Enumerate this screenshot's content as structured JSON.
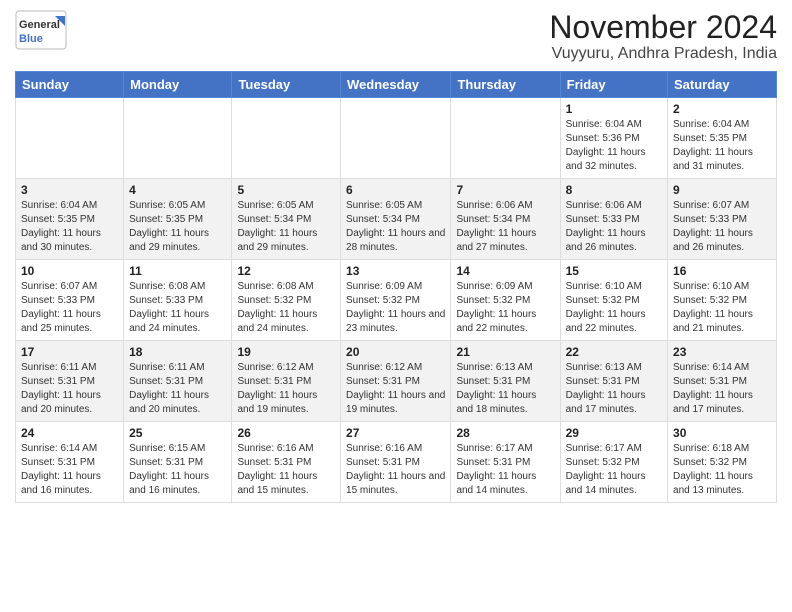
{
  "logo": {
    "line1": "General",
    "line2": "Blue"
  },
  "header": {
    "month": "November 2024",
    "location": "Vuyyuru, Andhra Pradesh, India"
  },
  "weekdays": [
    "Sunday",
    "Monday",
    "Tuesday",
    "Wednesday",
    "Thursday",
    "Friday",
    "Saturday"
  ],
  "weeks": [
    [
      {
        "day": "",
        "info": ""
      },
      {
        "day": "",
        "info": ""
      },
      {
        "day": "",
        "info": ""
      },
      {
        "day": "",
        "info": ""
      },
      {
        "day": "",
        "info": ""
      },
      {
        "day": "1",
        "info": "Sunrise: 6:04 AM\nSunset: 5:36 PM\nDaylight: 11 hours and 32 minutes."
      },
      {
        "day": "2",
        "info": "Sunrise: 6:04 AM\nSunset: 5:35 PM\nDaylight: 11 hours and 31 minutes."
      }
    ],
    [
      {
        "day": "3",
        "info": "Sunrise: 6:04 AM\nSunset: 5:35 PM\nDaylight: 11 hours and 30 minutes."
      },
      {
        "day": "4",
        "info": "Sunrise: 6:05 AM\nSunset: 5:35 PM\nDaylight: 11 hours and 29 minutes."
      },
      {
        "day": "5",
        "info": "Sunrise: 6:05 AM\nSunset: 5:34 PM\nDaylight: 11 hours and 29 minutes."
      },
      {
        "day": "6",
        "info": "Sunrise: 6:05 AM\nSunset: 5:34 PM\nDaylight: 11 hours and 28 minutes."
      },
      {
        "day": "7",
        "info": "Sunrise: 6:06 AM\nSunset: 5:34 PM\nDaylight: 11 hours and 27 minutes."
      },
      {
        "day": "8",
        "info": "Sunrise: 6:06 AM\nSunset: 5:33 PM\nDaylight: 11 hours and 26 minutes."
      },
      {
        "day": "9",
        "info": "Sunrise: 6:07 AM\nSunset: 5:33 PM\nDaylight: 11 hours and 26 minutes."
      }
    ],
    [
      {
        "day": "10",
        "info": "Sunrise: 6:07 AM\nSunset: 5:33 PM\nDaylight: 11 hours and 25 minutes."
      },
      {
        "day": "11",
        "info": "Sunrise: 6:08 AM\nSunset: 5:33 PM\nDaylight: 11 hours and 24 minutes."
      },
      {
        "day": "12",
        "info": "Sunrise: 6:08 AM\nSunset: 5:32 PM\nDaylight: 11 hours and 24 minutes."
      },
      {
        "day": "13",
        "info": "Sunrise: 6:09 AM\nSunset: 5:32 PM\nDaylight: 11 hours and 23 minutes."
      },
      {
        "day": "14",
        "info": "Sunrise: 6:09 AM\nSunset: 5:32 PM\nDaylight: 11 hours and 22 minutes."
      },
      {
        "day": "15",
        "info": "Sunrise: 6:10 AM\nSunset: 5:32 PM\nDaylight: 11 hours and 22 minutes."
      },
      {
        "day": "16",
        "info": "Sunrise: 6:10 AM\nSunset: 5:32 PM\nDaylight: 11 hours and 21 minutes."
      }
    ],
    [
      {
        "day": "17",
        "info": "Sunrise: 6:11 AM\nSunset: 5:31 PM\nDaylight: 11 hours and 20 minutes."
      },
      {
        "day": "18",
        "info": "Sunrise: 6:11 AM\nSunset: 5:31 PM\nDaylight: 11 hours and 20 minutes."
      },
      {
        "day": "19",
        "info": "Sunrise: 6:12 AM\nSunset: 5:31 PM\nDaylight: 11 hours and 19 minutes."
      },
      {
        "day": "20",
        "info": "Sunrise: 6:12 AM\nSunset: 5:31 PM\nDaylight: 11 hours and 19 minutes."
      },
      {
        "day": "21",
        "info": "Sunrise: 6:13 AM\nSunset: 5:31 PM\nDaylight: 11 hours and 18 minutes."
      },
      {
        "day": "22",
        "info": "Sunrise: 6:13 AM\nSunset: 5:31 PM\nDaylight: 11 hours and 17 minutes."
      },
      {
        "day": "23",
        "info": "Sunrise: 6:14 AM\nSunset: 5:31 PM\nDaylight: 11 hours and 17 minutes."
      }
    ],
    [
      {
        "day": "24",
        "info": "Sunrise: 6:14 AM\nSunset: 5:31 PM\nDaylight: 11 hours and 16 minutes."
      },
      {
        "day": "25",
        "info": "Sunrise: 6:15 AM\nSunset: 5:31 PM\nDaylight: 11 hours and 16 minutes."
      },
      {
        "day": "26",
        "info": "Sunrise: 6:16 AM\nSunset: 5:31 PM\nDaylight: 11 hours and 15 minutes."
      },
      {
        "day": "27",
        "info": "Sunrise: 6:16 AM\nSunset: 5:31 PM\nDaylight: 11 hours and 15 minutes."
      },
      {
        "day": "28",
        "info": "Sunrise: 6:17 AM\nSunset: 5:31 PM\nDaylight: 11 hours and 14 minutes."
      },
      {
        "day": "29",
        "info": "Sunrise: 6:17 AM\nSunset: 5:32 PM\nDaylight: 11 hours and 14 minutes."
      },
      {
        "day": "30",
        "info": "Sunrise: 6:18 AM\nSunset: 5:32 PM\nDaylight: 11 hours and 13 minutes."
      }
    ]
  ]
}
